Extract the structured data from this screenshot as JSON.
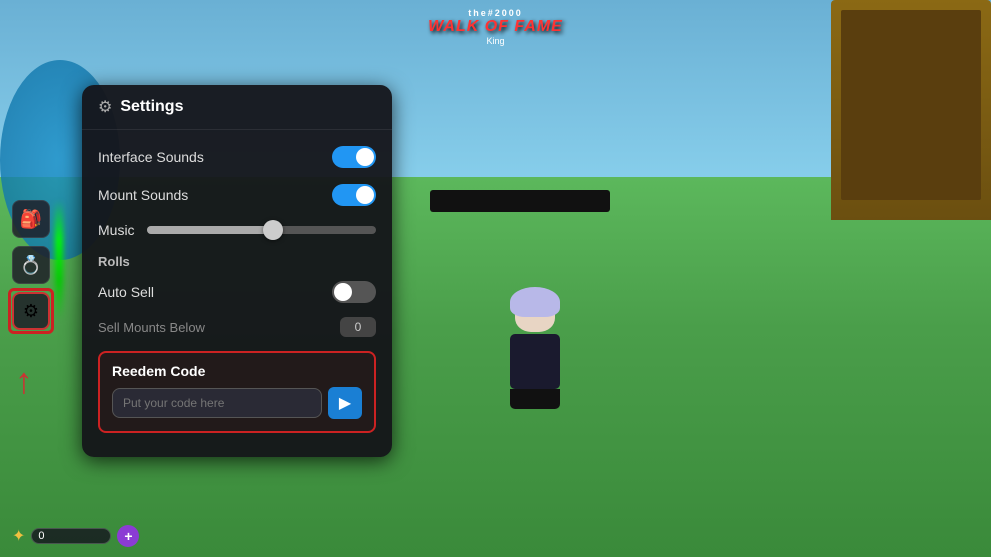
{
  "game": {
    "title_small": "the#2000",
    "title_main": "WALK OF FAME",
    "player_label": "King"
  },
  "sidebar": {
    "icons": [
      {
        "name": "backpack-icon",
        "symbol": "🎒",
        "active": false
      },
      {
        "name": "ring-icon",
        "symbol": "💍",
        "active": false
      },
      {
        "name": "settings-icon",
        "symbol": "⚙",
        "active": true
      }
    ]
  },
  "bottom_bar": {
    "currency_value": "0",
    "star_symbol": "✦",
    "plus_symbol": "+"
  },
  "settings": {
    "title": "Settings",
    "gear_symbol": "⚙",
    "items": [
      {
        "label": "Interface Sounds",
        "type": "toggle",
        "value": true
      },
      {
        "label": "Mount Sounds",
        "type": "toggle",
        "value": true
      },
      {
        "label": "Music",
        "type": "slider",
        "value": 55
      }
    ],
    "rolls_section": "Rolls",
    "auto_sell_label": "Auto Sell",
    "auto_sell_value": false,
    "sell_mounts_label": "Sell Mounts Below",
    "sell_mounts_value": "0",
    "redeem": {
      "title": "Reedem Code",
      "placeholder": "Put your code here",
      "button_symbol": "▶"
    }
  },
  "arrows": {
    "up_symbol": "↑"
  }
}
